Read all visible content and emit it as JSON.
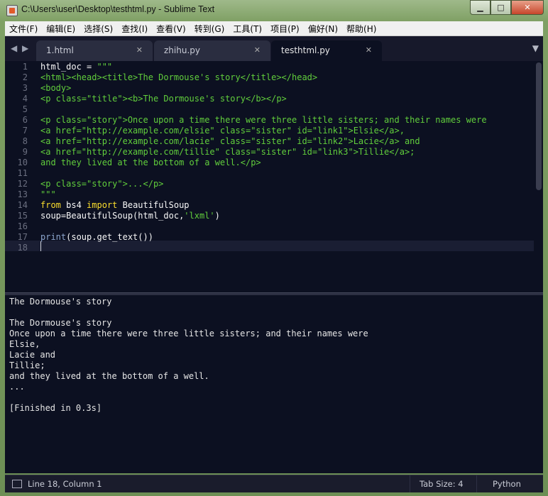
{
  "window": {
    "title": "C:\\Users\\user\\Desktop\\testhtml.py - Sublime Text"
  },
  "menu": [
    "文件(F)",
    "编辑(E)",
    "选择(S)",
    "查找(I)",
    "查看(V)",
    "转到(G)",
    "工具(T)",
    "项目(P)",
    "偏好(N)",
    "帮助(H)"
  ],
  "tabs": [
    {
      "label": "1.html"
    },
    {
      "label": "zhihu.py"
    },
    {
      "label": "testhtml.py"
    }
  ],
  "editor": {
    "line_numbers": [
      "1",
      "2",
      "3",
      "4",
      "5",
      "6",
      "7",
      "8",
      "9",
      "10",
      "11",
      "12",
      "13",
      "14",
      "15",
      "16",
      "17",
      "18"
    ],
    "lines": [
      [
        [
          "plain",
          "html_doc = "
        ],
        [
          "str",
          "\"\"\""
        ]
      ],
      [
        [
          "str",
          "<html><head><title>The Dormouse's story</title></head>"
        ]
      ],
      [
        [
          "str",
          "<body>"
        ]
      ],
      [
        [
          "str",
          "<p class=\"title\"><b>The Dormouse's story</b></p>"
        ]
      ],
      [],
      [
        [
          "str",
          "<p class=\"story\">Once upon a time there were three little sisters; and their names were"
        ]
      ],
      [
        [
          "str",
          "<a href=\"http://example.com/elsie\" class=\"sister\" id=\"link1\">Elsie</a>,"
        ]
      ],
      [
        [
          "str",
          "<a href=\"http://example.com/lacie\" class=\"sister\" id=\"link2\">Lacie</a> and"
        ]
      ],
      [
        [
          "str",
          "<a href=\"http://example.com/tillie\" class=\"sister\" id=\"link3\">Tillie</a>;"
        ]
      ],
      [
        [
          "str",
          "and they lived at the bottom of a well.</p>"
        ]
      ],
      [],
      [
        [
          "str",
          "<p class=\"story\">...</p>"
        ]
      ],
      [
        [
          "str",
          "\"\"\""
        ]
      ],
      [
        [
          "kw",
          "from"
        ],
        [
          "plain",
          " bs4 "
        ],
        [
          "kw",
          "import"
        ],
        [
          "plain",
          " BeautifulSoup"
        ]
      ],
      [
        [
          "plain",
          "soup=BeautifulSoup(html_doc,"
        ],
        [
          "str",
          "'lxml'"
        ],
        [
          "plain",
          ")"
        ]
      ],
      [],
      [
        [
          "fn",
          "print"
        ],
        [
          "plain",
          "(soup.get_text())"
        ]
      ],
      []
    ]
  },
  "output": {
    "lines": [
      "The Dormouse's story",
      "",
      "The Dormouse's story",
      "Once upon a time there were three little sisters; and their names were",
      "Elsie,",
      "Lacie and",
      "Tillie;",
      "and they lived at the bottom of a well.",
      "...",
      "",
      "[Finished in 0.3s]"
    ]
  },
  "status": {
    "position": "Line 18, Column 1",
    "tab_size": "Tab Size: 4",
    "syntax": "Python"
  },
  "colors": {
    "editor_bg": "#0c1021",
    "string": "#61ce3c",
    "keyword": "#fbde2d",
    "builtin": "#8da6ce"
  }
}
